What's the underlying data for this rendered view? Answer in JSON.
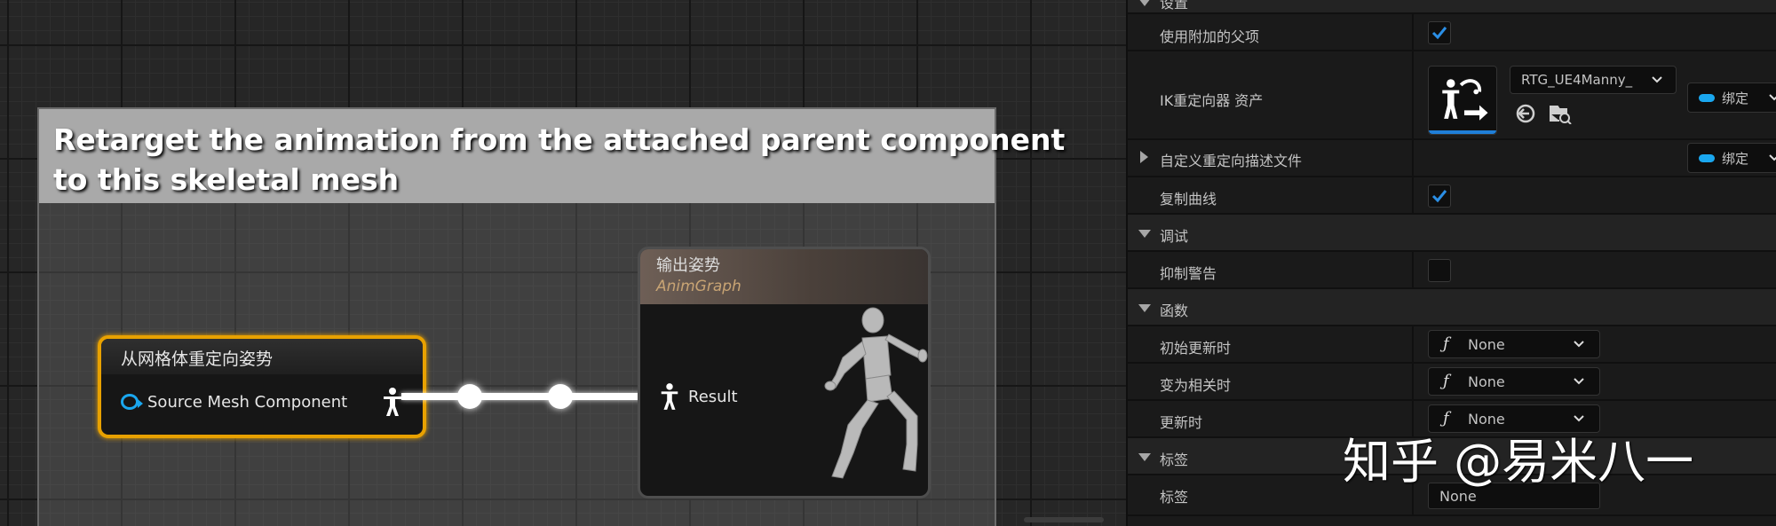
{
  "graph": {
    "comment": {
      "line1": "Retarget the animation from the attached parent component",
      "line2": "to this skeletal mesh"
    },
    "source_node": {
      "title": "从网格体重定向姿势",
      "pin_label": "Source Mesh Component"
    },
    "output_node": {
      "title": "输出姿势",
      "subtitle": "AnimGraph",
      "pin_label": "Result"
    }
  },
  "details": {
    "section_settings": "设置",
    "use_attached_parent": {
      "label": "使用附加的父项",
      "checked": true
    },
    "ik_retargeter": {
      "label": "IK重定向器 资产",
      "asset_name": "RTG_UE4Manny_",
      "bind_label": "绑定"
    },
    "custom_profile": {
      "label": "自定义重定向描述文件",
      "bind_label": "绑定"
    },
    "copy_curves": {
      "label": "复制曲线",
      "checked": true
    },
    "section_debug": "调试",
    "suppress_warnings": {
      "label": "抑制警告",
      "checked": false
    },
    "section_functions": "函数",
    "on_initial_update": {
      "label": "初始更新时",
      "value": "None"
    },
    "on_become_relevant": {
      "label": "变为相关时",
      "value": "None"
    },
    "on_update": {
      "label": "更新时",
      "value": "None"
    },
    "section_tags": "标签",
    "tag": {
      "label": "标签",
      "value": "None"
    }
  },
  "watermark": "知乎 @易米八一",
  "colors": {
    "selection_orange": "#e8a100",
    "pin_blue": "#1aa7ef",
    "checkbox_blue": "#1f7fd8"
  }
}
